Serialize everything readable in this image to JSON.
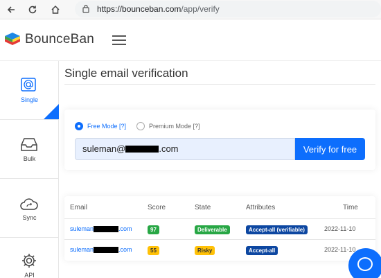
{
  "browser": {
    "url_host": "https://bounceban.com",
    "url_path": "/app/verify",
    "back_icon": "arrow-left-icon",
    "reload_icon": "reload-icon",
    "home_icon": "home-icon",
    "security_icon": "page-info-icon"
  },
  "header": {
    "logo_text": "BounceBan",
    "menu_icon": "hamburger-menu-icon"
  },
  "sidebar": {
    "items": [
      {
        "label": "Single",
        "icon": "at-sign-icon",
        "active": true
      },
      {
        "label": "Bulk",
        "icon": "inbox-icon",
        "active": false
      },
      {
        "label": "Sync",
        "icon": "cloud-sync-icon",
        "active": false
      },
      {
        "label": "API",
        "icon": "gear-icon",
        "active": false
      }
    ]
  },
  "main": {
    "title": "Single email verification",
    "modes": [
      {
        "label": "Free Mode [?]",
        "checked": true
      },
      {
        "label": "Premium Mode [?]",
        "checked": false
      }
    ],
    "email_prefix": "suleman@",
    "email_suffix": ".com",
    "verify_button": "Verify for free"
  },
  "results": {
    "columns": [
      "Email",
      "Score",
      "State",
      "Attributes",
      "Time"
    ],
    "rows": [
      {
        "email_prefix": "suleman",
        "email_suffix": ".com",
        "score": "97",
        "state": "Deliverable",
        "attributes": "Accept-all (verifiable)",
        "time": "2022-11-10"
      },
      {
        "email_prefix": "suleman",
        "email_suffix": ".com",
        "score": "55",
        "state": "Risky",
        "attributes": "Accept-all",
        "time": "2022-11-10"
      }
    ]
  },
  "colors": {
    "accent": "#0d6efd",
    "deliverable": "#28a745",
    "risky": "#ffc107",
    "attribute": "#0d47a1"
  },
  "chat": {
    "icon": "chat-bubble-icon"
  }
}
